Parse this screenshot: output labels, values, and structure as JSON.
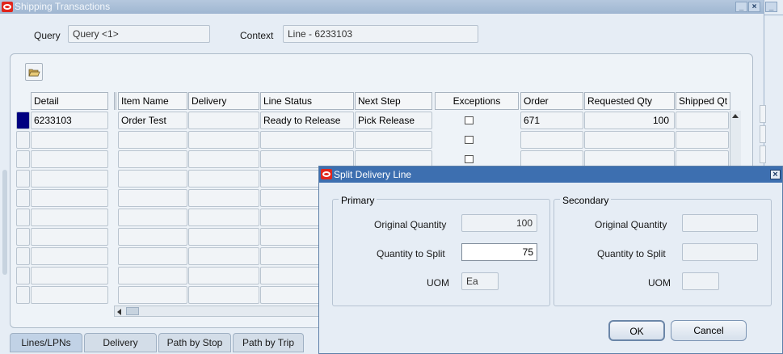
{
  "window": {
    "title": "Shipping Transactions",
    "controls": [
      "_",
      "×",
      "_",
      "×"
    ]
  },
  "header": {
    "query_label": "Query",
    "query_value": "Query <1>",
    "context_label": "Context",
    "context_value": "Line - 6233103"
  },
  "table": {
    "columns": [
      "Detail",
      "Item Name",
      "Delivery",
      "Line Status",
      "Next Step",
      "Exceptions",
      "Order",
      "Requested Qty",
      "Shipped Qt"
    ],
    "rows": [
      {
        "detail": "6233103",
        "item_name": "Order Test",
        "delivery": "",
        "line_status": "Ready to Release",
        "next_step": "Pick Release",
        "order": "671",
        "requested_qty": "100",
        "shipped_qty": ""
      }
    ]
  },
  "tabs": [
    "Lines/LPNs",
    "Delivery",
    "Path by Stop",
    "Path by Trip"
  ],
  "dialog": {
    "title": "Split Delivery Line",
    "primary": {
      "label": "Primary",
      "original_quantity_label": "Original Quantity",
      "original_quantity": "100",
      "quantity_to_split_label": "Quantity to Split",
      "quantity_to_split": "75",
      "uom_label": "UOM",
      "uom": "Ea"
    },
    "secondary": {
      "label": "Secondary",
      "original_quantity_label": "Original Quantity",
      "original_quantity": "",
      "quantity_to_split_label": "Quantity to Split",
      "quantity_to_split": "",
      "uom_label": "UOM",
      "uom": ""
    },
    "ok_label": "OK",
    "cancel_label": "Cancel",
    "close_glyph": "×"
  },
  "icons": {
    "folder": "folder-icon",
    "oracle": "oracle-logo-icon"
  },
  "colors": {
    "selection": "#000080",
    "dialog_title": "#3d6fb0"
  }
}
